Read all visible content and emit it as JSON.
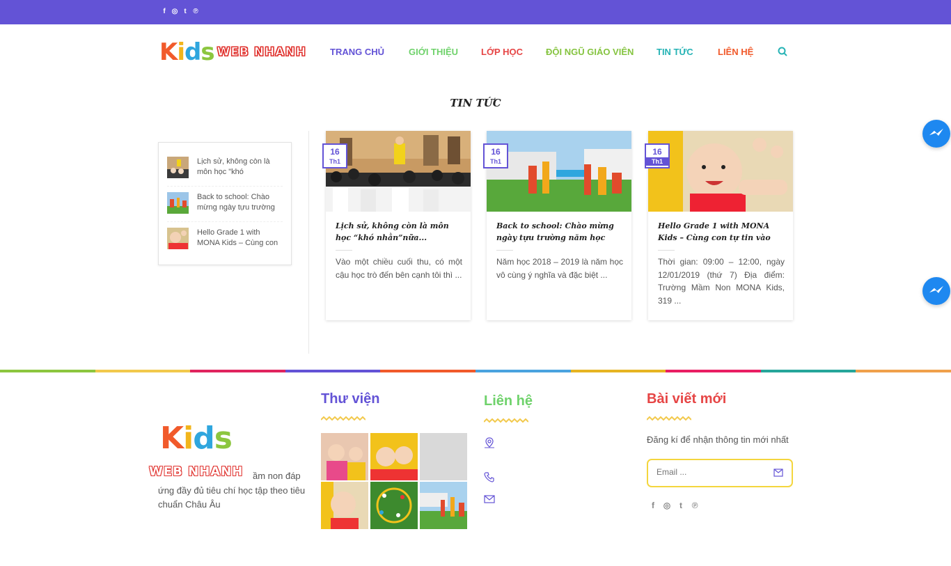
{
  "topbar": {
    "social": [
      "f",
      "◎",
      "t",
      "℗"
    ]
  },
  "logo": {
    "kids_letters": [
      "K",
      "i",
      "d",
      "s"
    ],
    "web_text": "WEB NHANH"
  },
  "nav": {
    "items": [
      {
        "label": "TRANG CHỦ",
        "color": "#6353d6"
      },
      {
        "label": "GIỚI THIỆU",
        "color": "#6fd26b"
      },
      {
        "label": "LỚP HỌC",
        "color": "#e64545"
      },
      {
        "label": "ĐỘI NGŨ GIÁO VIÊN",
        "color": "#86c441"
      },
      {
        "label": "TIN TỨC",
        "color": "#26b3b5"
      },
      {
        "label": "LIÊN HỆ",
        "color": "#f15a2b"
      }
    ]
  },
  "section": {
    "title": "TIN TỨC"
  },
  "sidebar": {
    "items": [
      {
        "title": "Lịch sử, không còn là môn học \"khó"
      },
      {
        "title": "Back to school: Chào mừng ngày tựu trường"
      },
      {
        "title": "Hello Grade 1 with MONA Kids – Cùng con"
      }
    ]
  },
  "posts": [
    {
      "day": "16",
      "month": "Th1",
      "title": "Lịch sử, không còn là môn học “khó nhằn”nữa...",
      "excerpt": "Vào một chiều cuối thu, có một cậu học trò đến bên cạnh tôi thì ..."
    },
    {
      "day": "16",
      "month": "Th1",
      "title": "Back to school: Chào mừng ngày tựu trường năm học",
      "excerpt": "Năm học 2018 – 2019 là năm học vô cùng ý nghĩa và đặc biệt ..."
    },
    {
      "day": "16",
      "month": "Th1",
      "title": "Hello Grade 1 with MONA Kids – Cùng con tự tin vào",
      "excerpt": "Thời gian: 09:00 – 12:00, ngày 12/01/2019 (thứ 7) Địa điểm: Trường Mầm Non MONA Kids, 319 ..."
    }
  ],
  "footer": {
    "logo_web": "WEB NHANH",
    "desc": "ầm non đáp ứng đầy đủ tiêu chí học tập theo tiêu chuẩn Châu Âu",
    "library_title": "Thư viện",
    "contact_title": "Liên hệ",
    "news_title": "Bài viết mới",
    "subscribe_text": "Đăng kí để nhận thông tin mới nhất",
    "email_placeholder": "Email ...",
    "social": [
      "f",
      "◎",
      "t",
      "℗"
    ]
  },
  "colors": {
    "primary": "#6353d6",
    "rainbow": [
      "#8cc63f",
      "#f2c94c",
      "#e0245e",
      "#6353d6",
      "#f15a2b",
      "#4aa3df",
      "#e6b422",
      "#e91e63",
      "#26a69a",
      "#f0a04b"
    ]
  }
}
